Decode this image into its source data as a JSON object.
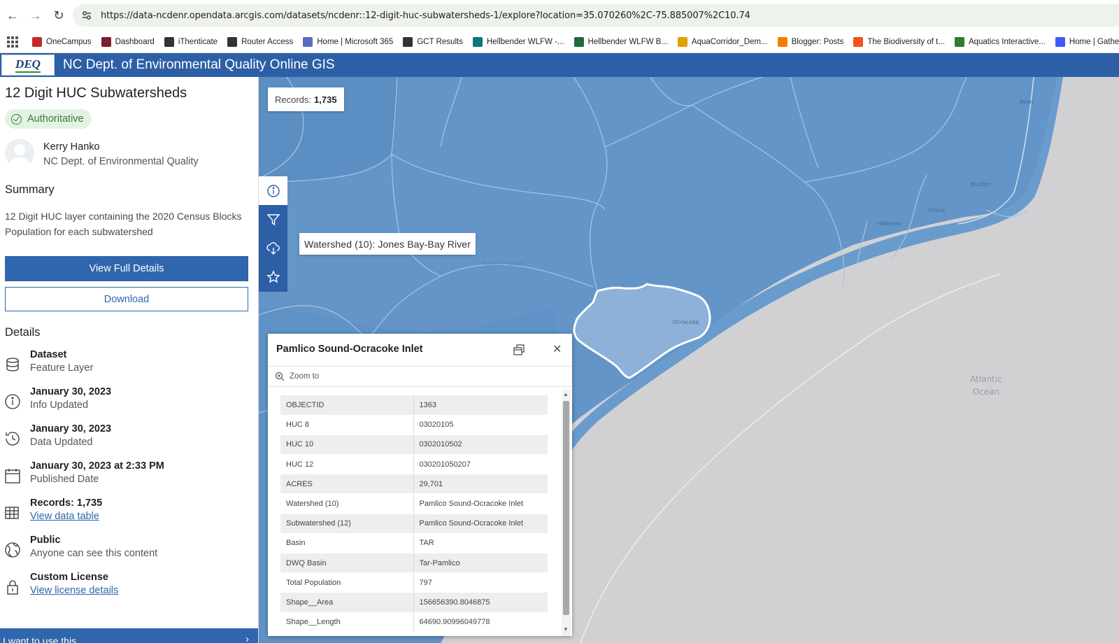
{
  "browser": {
    "url": "https://data-ncdenr.opendata.arcgis.com/datasets/ncdenr::12-digit-huc-subwatersheds-1/explore?location=35.070260%2C-75.885007%2C10.74",
    "bookmarks": [
      {
        "label": "OneCampus",
        "color": "#c62828"
      },
      {
        "label": "Dashboard",
        "color": "#7b1f2e"
      },
      {
        "label": "iThenticate",
        "color": "#333333"
      },
      {
        "label": "Router Access",
        "color": "#333333"
      },
      {
        "label": "Home | Microsoft 365",
        "color": "#5c6bc0"
      },
      {
        "label": "GCT Results",
        "color": "#333333"
      },
      {
        "label": "Hellbender WLFW -...",
        "color": "#0b7a75"
      },
      {
        "label": "Hellbender WLFW B...",
        "color": "#1e6b3a"
      },
      {
        "label": "AquaCorridor_Dem...",
        "color": "#e0a100"
      },
      {
        "label": "Blogger: Posts",
        "color": "#f57c00"
      },
      {
        "label": "The Biodiversity of t...",
        "color": "#f4511e"
      },
      {
        "label": "Aquatics Interactive...",
        "color": "#2e7d32"
      },
      {
        "label": "Home | Gather",
        "color": "#3d5afe"
      }
    ]
  },
  "app": {
    "logo_text": "DEQ",
    "title": "NC Dept. of Environmental Quality Online GIS"
  },
  "sidebar": {
    "title": "12 Digit HUC Subwatersheds",
    "badge": "Authoritative",
    "owner_name": "Kerry Hanko",
    "owner_org": "NC Dept. of Environmental Quality",
    "summary_heading": "Summary",
    "summary_text": "12 Digit HUC layer containing the 2020 Census Blocks Population for each subwatershed",
    "view_full_details": "View Full Details",
    "download": "Download",
    "details_heading": "Details",
    "details": [
      {
        "title": "Dataset",
        "sub": "Feature Layer",
        "icon": "database-icon"
      },
      {
        "title": "January 30, 2023",
        "sub": "Info Updated",
        "icon": "info-icon"
      },
      {
        "title": "January 30, 2023",
        "sub": "Data Updated",
        "icon": "history-icon"
      },
      {
        "title": "January 30, 2023 at 2:33 PM",
        "sub": "Published Date",
        "icon": "calendar-icon"
      },
      {
        "title": "Records: 1,735",
        "sub": "View data table",
        "icon": "table-icon"
      },
      {
        "title": "Public",
        "sub": "Anyone can see this content",
        "icon": "globe-icon"
      },
      {
        "title": "Custom License",
        "sub": "View license details",
        "icon": "lock-icon"
      }
    ],
    "use_bar": "I want to use this"
  },
  "map": {
    "records_label": "Records:",
    "records_value": "1,735",
    "tooltip": "Watershed (10): Jones Bay-Bay River",
    "place_labels": [
      "Avon",
      "Buxton",
      "Frisco",
      "Hatteras",
      "Ocracoke",
      "Pamlico Sound",
      "Atlantic",
      "Ocean"
    ],
    "colors": {
      "land": "#6395c8",
      "selected": "#8db1d8",
      "ocean": "#d1d1d4",
      "boundary": "#a9c3e2"
    }
  },
  "popup": {
    "title": "Pamlico Sound-Ocracoke Inlet",
    "zoom_to": "Zoom to",
    "attributes": [
      {
        "key": "OBJECTID",
        "value": "1363"
      },
      {
        "key": "HUC 8",
        "value": "03020105"
      },
      {
        "key": "HUC 10",
        "value": "0302010502"
      },
      {
        "key": "HUC 12",
        "value": "030201050207"
      },
      {
        "key": "ACRES",
        "value": "29,701"
      },
      {
        "key": "Watershed (10)",
        "value": "Pamlico Sound-Ocracoke Inlet"
      },
      {
        "key": "Subwatershed (12)",
        "value": "Pamlico Sound-Ocracoke Inlet"
      },
      {
        "key": "Basin",
        "value": "TAR"
      },
      {
        "key": "DWQ Basin",
        "value": "Tar-Pamlico"
      },
      {
        "key": "Total Population",
        "value": "797"
      },
      {
        "key": "Shape__Area",
        "value": "156656390.8046875"
      },
      {
        "key": "Shape__Length",
        "value": "64690.90996049778"
      }
    ]
  }
}
